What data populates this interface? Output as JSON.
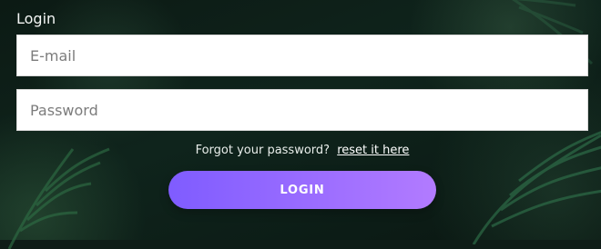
{
  "login": {
    "title": "Login",
    "email_placeholder": "E-mail",
    "password_placeholder": "Password",
    "forgot_prefix": "Forgot your password?",
    "forgot_link": "reset it here",
    "button_label": "LOGIN"
  },
  "colors": {
    "button_gradient_start": "#7f5cff",
    "button_gradient_end": "#b27bff"
  }
}
